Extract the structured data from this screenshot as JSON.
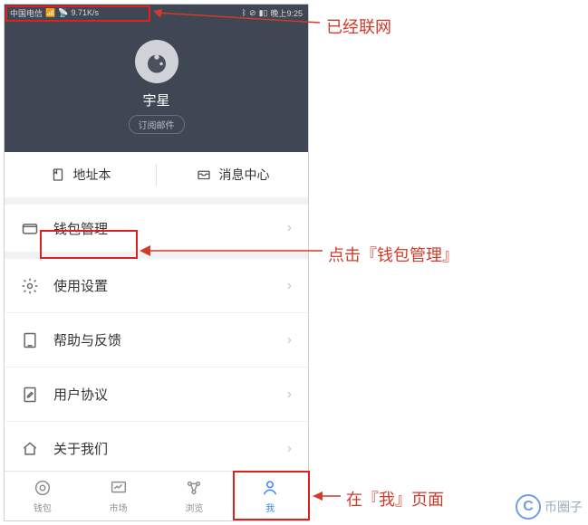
{
  "status_bar": {
    "carrier": "中国电信",
    "speed": "9.71K/s",
    "time": "晚上9:25"
  },
  "profile": {
    "username": "宇星",
    "subscribe_label": "订阅邮件"
  },
  "quick": {
    "address_book": "地址本",
    "message_center": "消息中心"
  },
  "menu": {
    "wallet_mgmt": "钱包管理",
    "usage_settings": "使用设置",
    "help_feedback": "帮助与反馈",
    "user_agreement": "用户协议",
    "about_us": "关于我们"
  },
  "nav": {
    "wallet": "钱包",
    "market": "市场",
    "browse": "浏览",
    "me": "我"
  },
  "annotations": {
    "connected": "已经联网",
    "click_wallet_mgmt": "点击『钱包管理』",
    "on_me_page": "在『我』页面"
  },
  "watermark": {
    "text": "币圈子"
  }
}
